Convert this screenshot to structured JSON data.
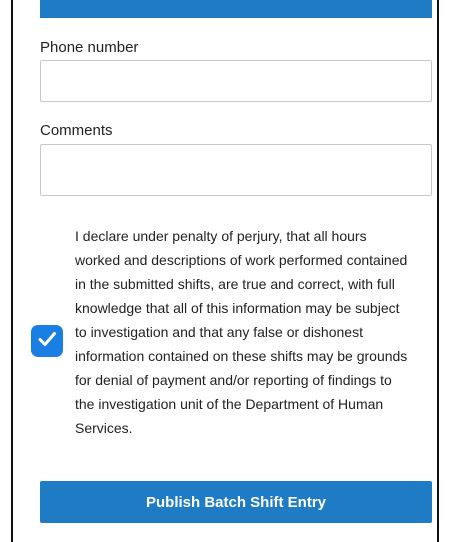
{
  "form": {
    "phone": {
      "label": "Phone number",
      "value": "",
      "placeholder": ""
    },
    "comments": {
      "label": "Comments",
      "value": "",
      "placeholder": ""
    },
    "declaration": {
      "checked": true,
      "lines": [
        "I declare under penalty of perjury, that all hours",
        "worked and descriptions of work performed contained",
        "in the submitted shifts, are true and correct, with full",
        "knowledge that all of this information may be subject",
        "to investigation and that any false or dishonest",
        "information contained on these shifts may be grounds",
        "for denial of payment and/or reporting of findings to",
        "the investigation unit of the Department of Human",
        "Services."
      ]
    },
    "submit_label": "Publish Batch Shift Entry"
  },
  "colors": {
    "accent": "#1f7bc4",
    "checkbox": "#1a7fe3"
  },
  "icons": {
    "checkbox": "checkmark-icon"
  }
}
